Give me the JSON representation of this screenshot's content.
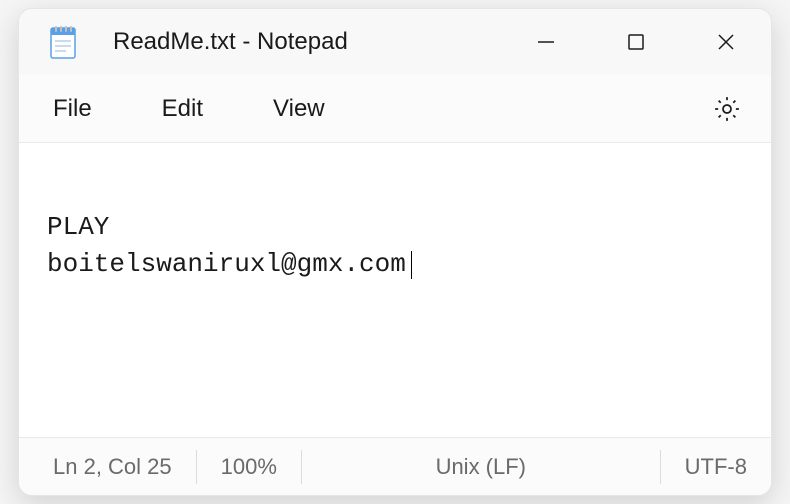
{
  "window": {
    "title": "ReadMe.txt - Notepad"
  },
  "menu": {
    "file": "File",
    "edit": "Edit",
    "view": "View"
  },
  "content": {
    "line1": "PLAY",
    "line2": "boitelswaniruxl@gmx.com"
  },
  "status": {
    "position": "Ln 2, Col 25",
    "zoom": "100%",
    "line_ending": "Unix (LF)",
    "encoding": "UTF-8"
  }
}
